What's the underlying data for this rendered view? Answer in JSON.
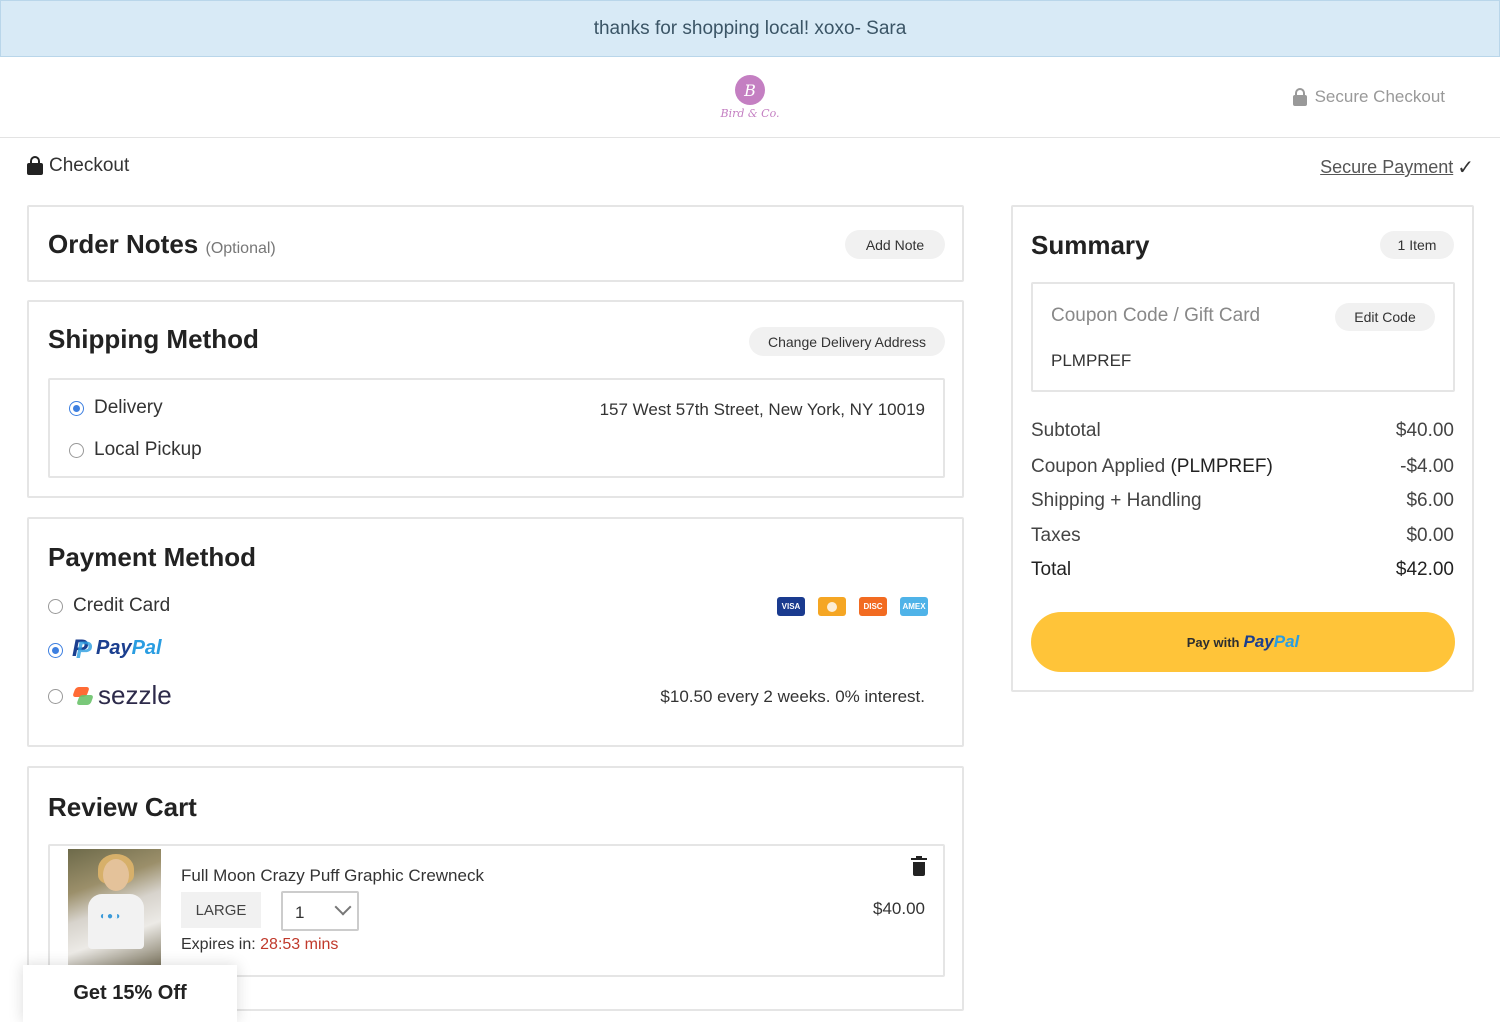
{
  "banner": {
    "text": "thanks for shopping local! xoxo- Sara"
  },
  "header": {
    "logo_mark": "B",
    "logo_text": "Bird & Co.",
    "secure_checkout": "Secure Checkout"
  },
  "subheader": {
    "checkout": "Checkout",
    "secure_payment": "Secure Payment"
  },
  "order_notes": {
    "title": "Order Notes",
    "optional": "(Optional)",
    "add_note": "Add Note"
  },
  "shipping": {
    "title": "Shipping Method",
    "change_address": "Change Delivery Address",
    "options": [
      {
        "label": "Delivery",
        "selected": true
      },
      {
        "label": "Local Pickup",
        "selected": false
      }
    ],
    "address": "157 West 57th Street, New York, NY 10019"
  },
  "payment": {
    "title": "Payment Method",
    "options": [
      {
        "label": "Credit Card",
        "selected": false
      },
      {
        "label": "PayPal",
        "selected": true
      },
      {
        "label": "sezzle",
        "selected": false
      }
    ],
    "paypal_pay": "Pay",
    "paypal_pal": "Pal",
    "card_icons": [
      {
        "name": "visa-icon",
        "label": "VISA",
        "color": "#1a3b8f"
      },
      {
        "name": "mastercard-icon",
        "label": "",
        "color": "#f5a623"
      },
      {
        "name": "discover-icon",
        "label": "DISC",
        "color": "#f26b21"
      },
      {
        "name": "amex-icon",
        "label": "AMEX",
        "color": "#4fb3e8"
      }
    ],
    "sezzle_info": "$10.50 every 2 weeks. 0% interest."
  },
  "cart": {
    "title": "Review Cart",
    "item": {
      "name": "Full Moon Crazy Puff Graphic Crewneck",
      "size": "LARGE",
      "qty": "1",
      "price": "$40.00",
      "expires_label": "Expires in:",
      "expires_time": "28:53 mins"
    }
  },
  "promo": {
    "label": "Get 15% Off"
  },
  "summary": {
    "title": "Summary",
    "items_badge": "1 Item",
    "coupon_placeholder": "Coupon Code / Gift Card",
    "edit_code": "Edit Code",
    "coupon_value": "PLMPREF",
    "rows": {
      "subtotal_label": "Subtotal",
      "subtotal_value": "$40.00",
      "coupon_label": "Coupon Applied",
      "coupon_code": "(PLMPREF)",
      "coupon_value": "-$4.00",
      "shipping_label": "Shipping + Handling",
      "shipping_value": "$6.00",
      "taxes_label": "Taxes",
      "taxes_value": "$0.00",
      "total_label": "Total",
      "total_value": "$42.00"
    },
    "pay_with": "Pay with",
    "pay_pay": "Pay",
    "pay_pal": "Pal"
  },
  "colors": {
    "banner_bg": "#d8eaf6",
    "accent_blue": "#3d7fe0",
    "paypal_button": "#ffc439",
    "timer_red": "#c0392b"
  }
}
